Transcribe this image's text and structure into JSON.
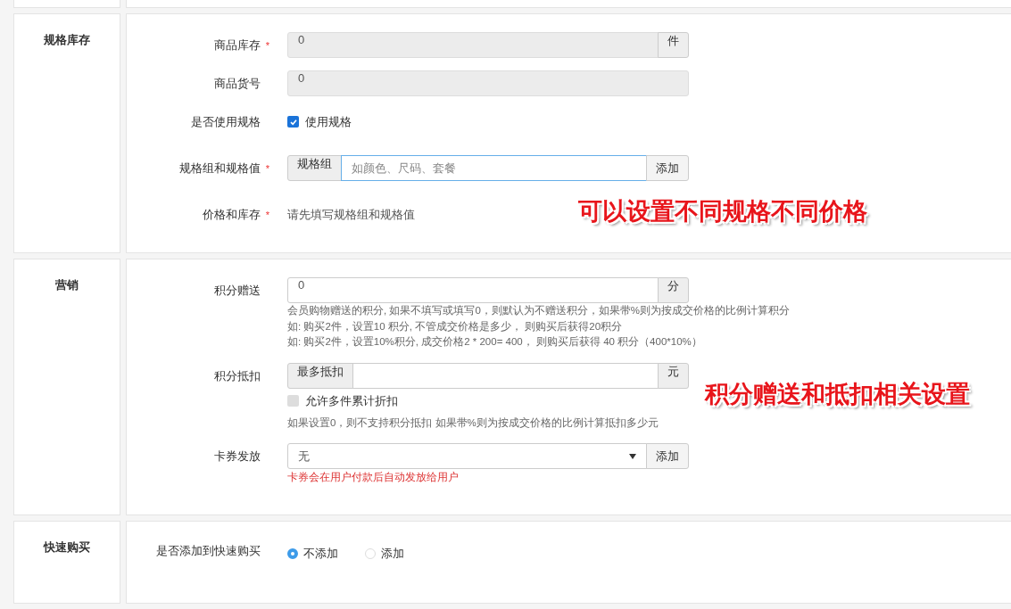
{
  "sections": [
    {
      "title": "规格库存",
      "rows": [
        {
          "kind": "input",
          "label": "商品库存",
          "mark": "*",
          "value": "0",
          "disabled": true,
          "addon": "件"
        },
        {
          "kind": "input",
          "label": "商品货号",
          "value": "0",
          "disabled": true
        },
        {
          "kind": "checkbox",
          "label": "是否使用规格",
          "option": "使用规格",
          "checked": true
        },
        {
          "kind": "group",
          "label": "规格组和规格值",
          "mark": "*",
          "prefix": "规格组",
          "placeholder": "如颜色、尺码、套餐",
          "button": "添加"
        },
        {
          "kind": "text",
          "label": "价格和库存",
          "mark": "*",
          "text": "请先填写规格组和规格值"
        }
      ]
    },
    {
      "title": "营销",
      "rows": [
        {
          "kind": "input",
          "label": "积分赠送",
          "value": "0",
          "disabled": false,
          "addon": "分",
          "help": [
            "会员购物赠送的积分, 如果不填写或填写0，则默认为不赠送积分，如果带%则为按成交价格的比例计算积分",
            "如: 购买2件，设置10 积分, 不管成交价格是多少， 则购买后获得20积分",
            "如: 购买2件，设置10%积分, 成交价格2 * 200= 400， 则购买后获得 40 积分（400*10%）"
          ]
        },
        {
          "kind": "prefix",
          "label": "积分抵扣",
          "prefix": "最多抵扣",
          "addon": "元",
          "option": "允许多件累计折扣",
          "checked": false,
          "help": [
            "如果设置0，则不支持积分抵扣 如果带%则为按成交价格的比例计算抵扣多少元"
          ]
        },
        {
          "kind": "select",
          "label": "卡券发放",
          "value": "无",
          "button": "添加",
          "note": "卡券会在用户付款后自动发放给用户"
        }
      ]
    },
    {
      "title": "快速购买",
      "rows": [
        {
          "kind": "radio",
          "label": "是否添加到快速购买",
          "options": [
            {
              "label": "不添加",
              "selected": true
            },
            {
              "label": "添加",
              "selected": false
            }
          ]
        }
      ]
    }
  ],
  "annotations": [
    "可以设置不同规格不同价格",
    "积分赠送和抵扣相关设置"
  ]
}
